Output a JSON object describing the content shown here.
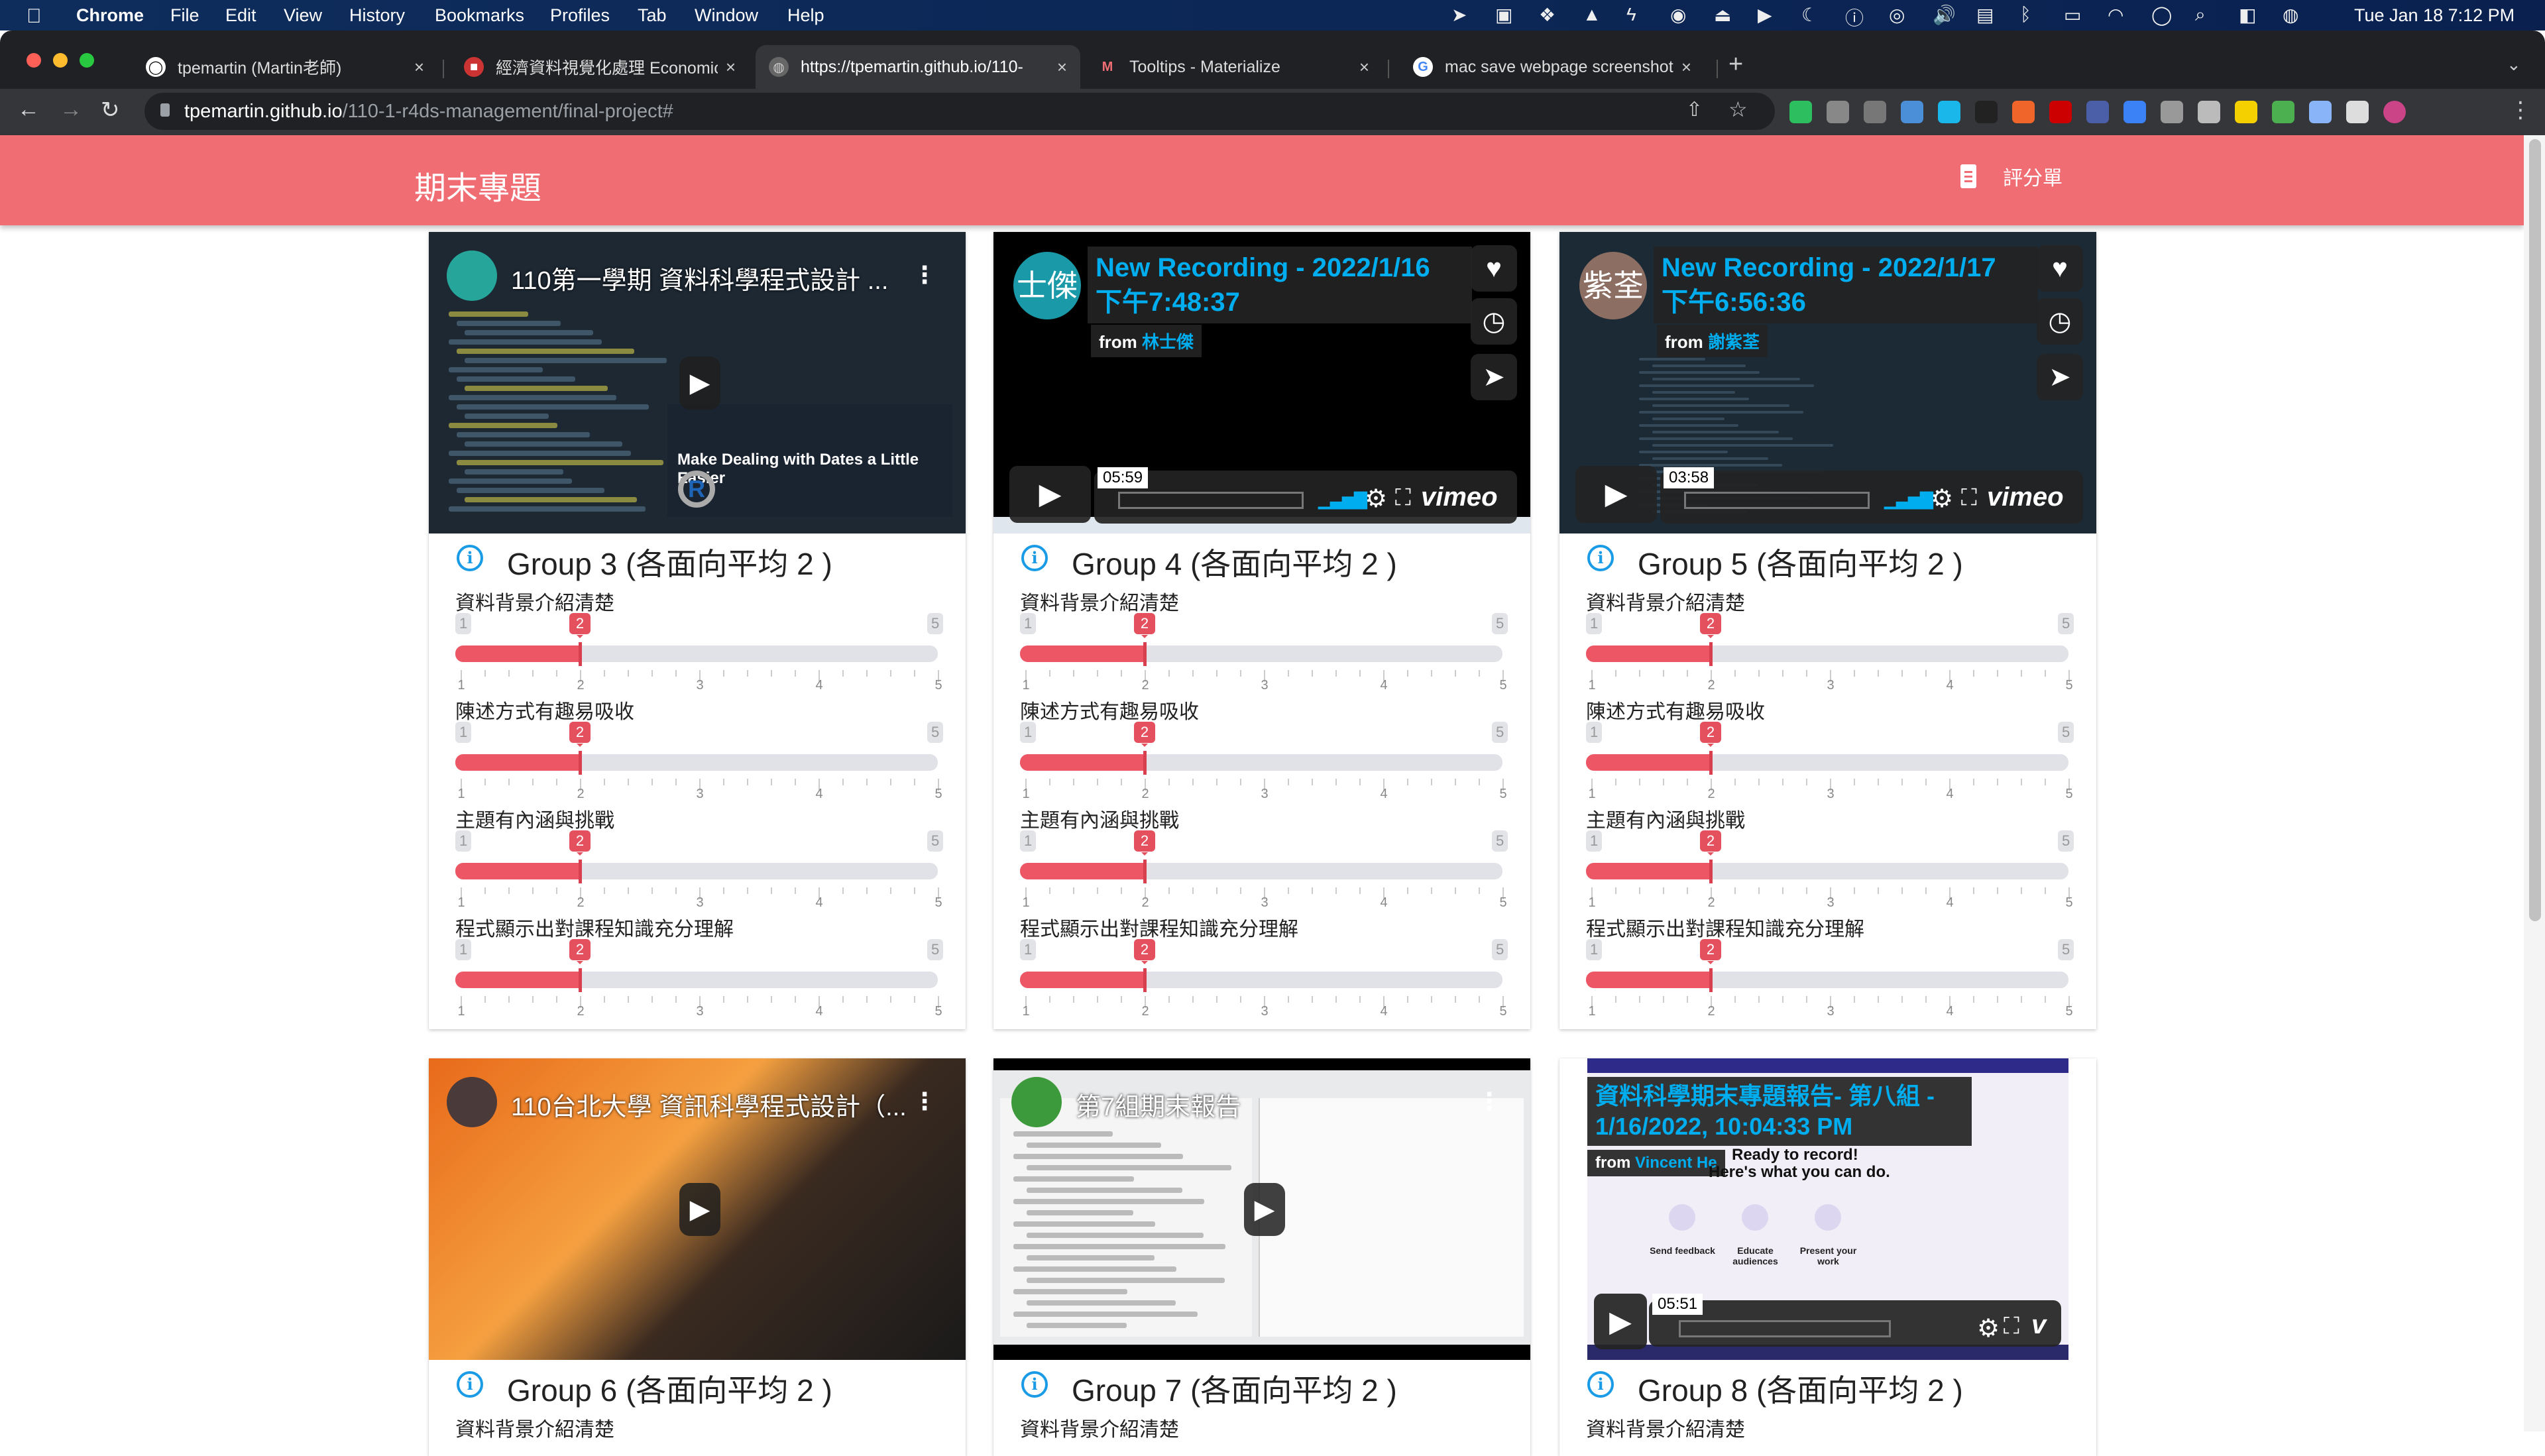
{
  "menubar": {
    "app": "Chrome",
    "items": [
      "File",
      "Edit",
      "View",
      "History",
      "Bookmarks",
      "Profiles",
      "Tab",
      "Window",
      "Help"
    ],
    "status_icons": [
      "location-icon",
      "screen-icon",
      "dropbox-icon",
      "drive-icon",
      "script-icon",
      "app-icon",
      "upload-icon",
      "play-icon",
      "moon-icon",
      "accessibility-icon",
      "airdrop-icon",
      "volume-icon",
      "flag-icon",
      "bluetooth-icon",
      "battery-icon",
      "wifi-icon",
      "user-icon",
      "spotlight-icon",
      "control-center-icon",
      "siri-icon"
    ],
    "clock": "Tue Jan 18  7:12 PM"
  },
  "browser": {
    "tabs": [
      {
        "title": "tpemartin (Martin老師)",
        "icon": "github-icon",
        "active": false
      },
      {
        "title": "經濟資料視覺化處理 Economic D",
        "icon": "site-icon",
        "active": false
      },
      {
        "title": "https://tpemartin.github.io/110-",
        "icon": "globe-icon",
        "active": true
      },
      {
        "title": "Tooltips - Materialize",
        "icon": "materialize-icon",
        "active": false
      },
      {
        "title": "mac save webpage screenshot",
        "icon": "google-icon",
        "active": false
      }
    ],
    "url_host": "tpemartin.github.io",
    "url_path": "/110-1-r4ds-management/final-project#",
    "extensions": [
      "evernote",
      "ext-gray",
      "hypothesis",
      "translate",
      "vimeo",
      "qr",
      "xml",
      "ext-red",
      "ext-blue",
      "pin",
      "ext-m",
      "ext-apple",
      "ext-yellow",
      "ext-tree",
      "ext-magnifier",
      "puzzle",
      "profile"
    ]
  },
  "header": {
    "title": "期末專題",
    "nav_label": "評分單",
    "accent": "#ef6d73"
  },
  "scale": {
    "min": "1",
    "max": "5",
    "ticks": [
      "1",
      "2",
      "3",
      "4",
      "5"
    ]
  },
  "groups": [
    {
      "title": "Group 3 (各面向平均 2 )",
      "video": {
        "type": "youtube",
        "title": "110第一學期 資料科學程式設計 ...",
        "subtitle": "Make Dealing with Dates a Little Easier"
      },
      "criteria": [
        {
          "label": "資料背景介紹清楚",
          "value": 2
        },
        {
          "label": "陳述方式有趣易吸收",
          "value": 2
        },
        {
          "label": "主題有內涵與挑戰",
          "value": 2
        },
        {
          "label": "程式顯示出對課程知識充分理解",
          "value": 2
        }
      ]
    },
    {
      "title": "Group 4 (各面向平均 2 )",
      "video": {
        "type": "vimeo",
        "avatar": "士傑",
        "avatar_color": "#1a9aa8",
        "title_line1": "New Recording - 2022/1/16",
        "title_line2": "下午7:48:37",
        "from": "from",
        "author": "林士傑",
        "duration": "05:59",
        "logo": "vimeo"
      },
      "criteria": [
        {
          "label": "資料背景介紹清楚",
          "value": 2
        },
        {
          "label": "陳述方式有趣易吸收",
          "value": 2
        },
        {
          "label": "主題有內涵與挑戰",
          "value": 2
        },
        {
          "label": "程式顯示出對課程知識充分理解",
          "value": 2
        }
      ]
    },
    {
      "title": "Group 5 (各面向平均 2 )",
      "video": {
        "type": "vimeo",
        "avatar": "紫荃",
        "avatar_color": "#8d6e63",
        "title_line1": "New Recording - 2022/1/17",
        "title_line2": "下午6:56:36",
        "from": "from",
        "author": "謝紫荃",
        "duration": "03:58",
        "logo": "vimeo"
      },
      "criteria": [
        {
          "label": "資料背景介紹清楚",
          "value": 2
        },
        {
          "label": "陳述方式有趣易吸收",
          "value": 2
        },
        {
          "label": "主題有內涵與挑戰",
          "value": 2
        },
        {
          "label": "程式顯示出對課程知識充分理解",
          "value": 2
        }
      ]
    },
    {
      "title": "Group 6 (各面向平均 2 )",
      "video": {
        "type": "youtube",
        "title": "110台北大學 資訊科學程式設計（..."
      },
      "criteria": [
        {
          "label": "資料背景介紹清楚"
        }
      ]
    },
    {
      "title": "Group 7 (各面向平均 2 )",
      "video": {
        "type": "youtube",
        "title": "第7組期末報告"
      },
      "criteria": [
        {
          "label": "資料背景介紹清楚"
        }
      ]
    },
    {
      "title": "Group 8 (各面向平均 2 )",
      "video": {
        "type": "vimeo-wide",
        "title_line1": "資料科學期末專題報告- 第八組 -",
        "title_line2": "1/16/2022, 10:04:33 PM",
        "from": "from",
        "author": "Vincent He",
        "duration": "05:51",
        "ready_line1": "Ready to record!",
        "ready_line2": "Here's what you can do.",
        "features": [
          "Send feedback",
          "Educate audiences",
          "Present your work"
        ]
      },
      "criteria": [
        {
          "label": "資料背景介紹清楚"
        }
      ]
    }
  ]
}
